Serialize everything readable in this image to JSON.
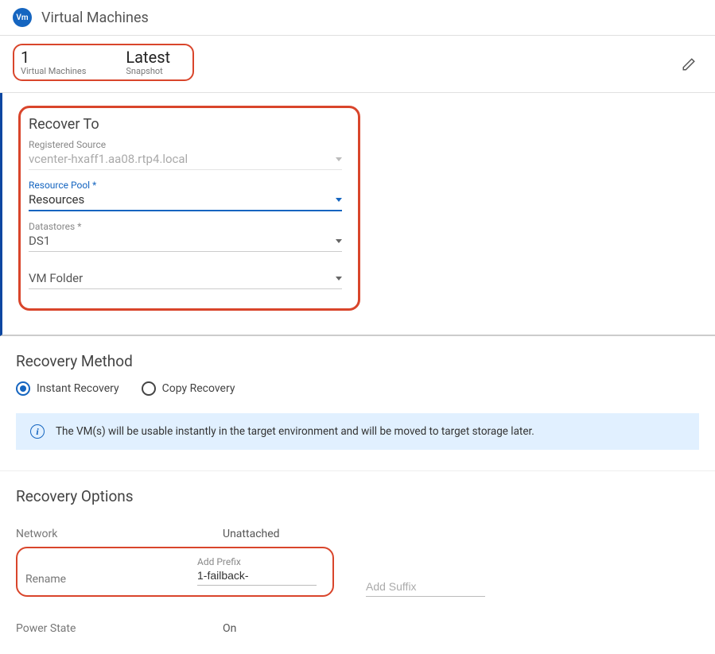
{
  "header": {
    "chip_text": "Vm",
    "title": "Virtual Machines"
  },
  "summary": {
    "vm_count": "1",
    "vm_label": "Virtual Machines",
    "snapshot_value": "Latest",
    "snapshot_label": "Snapshot"
  },
  "recover_to": {
    "title": "Recover To",
    "source_label": "Registered Source",
    "source_value": "vcenter-hxaff1.aa08.rtp4.local",
    "pool_label": "Resource Pool *",
    "pool_value": "Resources",
    "datastore_label": "Datastores *",
    "datastore_value": "DS1",
    "folder_value": "VM Folder"
  },
  "recovery_method": {
    "title": "Recovery Method",
    "option_instant": "Instant Recovery",
    "option_copy": "Copy Recovery",
    "info_text": "The VM(s) will be usable instantly in the target environment and will be moved to target storage later."
  },
  "recovery_options": {
    "title": "Recovery Options",
    "network_key": "Network",
    "network_value": "Unattached",
    "rename_key": "Rename",
    "prefix_label": "Add Prefix",
    "prefix_value": "1-failback-",
    "suffix_placeholder": "Add Suffix",
    "power_key": "Power State",
    "power_value": "On"
  }
}
